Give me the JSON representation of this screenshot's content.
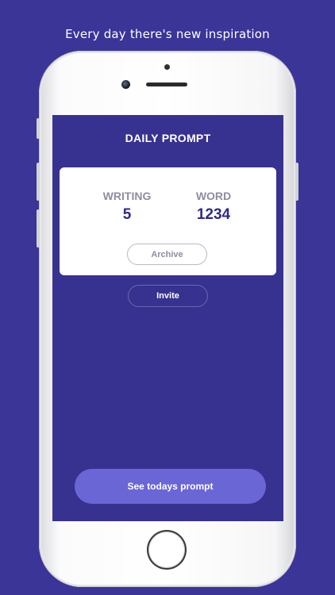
{
  "tagline": "Every day there's new inspiration",
  "app": {
    "title": "DAILY PROMPT",
    "stats": [
      {
        "label": "WRITING",
        "value": "5"
      },
      {
        "label": "WORD",
        "value": "1234"
      }
    ],
    "archive_label": "Archive",
    "invite_label": "Invite",
    "prompt_button_label": "See todays prompt"
  },
  "colors": {
    "background": "#3a3597",
    "screen": "#37328f",
    "accent_button": "#6a66d6",
    "stat_value": "#2f2b85",
    "stat_label": "#8e8ca3"
  }
}
